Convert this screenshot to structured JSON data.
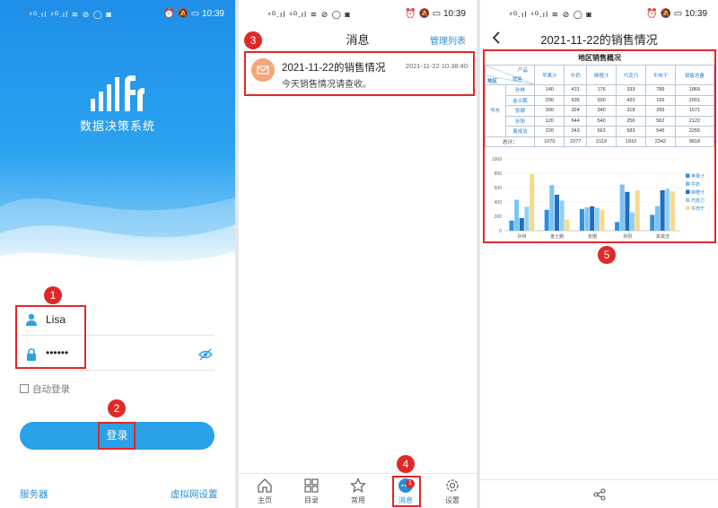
{
  "status": {
    "left_glyphs": "⁴ᴳ.ıl ⁴ᴳ.ıl ≋ ⊘ ◯ ◙",
    "right_glyphs": "⏰ 🔕 ▭",
    "time": "10:39"
  },
  "login": {
    "app_title": "数据决策系统",
    "username": "Lisa",
    "password_mask": "••••••",
    "auto_login": "自动登录",
    "login_button": "登录",
    "server_link": "服务器",
    "vpn_link": "虚拟网设置"
  },
  "messages": {
    "title": "消息",
    "manage": "管理列表",
    "item": {
      "title": "2021-11-22的销售情况",
      "time": "2021-11-22 10:38:40",
      "body": "今天销售情况请查收。"
    },
    "tabs": [
      {
        "label": "主页",
        "icon": "home-icon"
      },
      {
        "label": "目录",
        "icon": "grid-icon"
      },
      {
        "label": "常用",
        "icon": "star-icon"
      },
      {
        "label": "消息",
        "icon": "message-icon",
        "badge": "1"
      },
      {
        "label": "设置",
        "icon": "gear-icon"
      }
    ]
  },
  "report": {
    "title": "2021-11-22的销售情况",
    "table_title": "地区销售概况",
    "corner_product": "产品",
    "corner_seller": "销售",
    "corner_region": "地区",
    "products": [
      "苹果汁",
      "牛奶",
      "柳橙汁",
      "巧克力",
      "牛肉干",
      "销售总量"
    ],
    "region": "华东",
    "rows": [
      {
        "name": "孙林",
        "values": [
          "140",
          "431",
          "176",
          "333",
          "789",
          "1869"
        ]
      },
      {
        "name": "金士鹏",
        "values": [
          "290",
          "635",
          "500",
          "420",
          "156",
          "2001"
        ]
      },
      {
        "name": "张珊",
        "values": [
          "300",
          "324",
          "340",
          "318",
          "289",
          "1571"
        ]
      },
      {
        "name": "孙阳",
        "values": [
          "120",
          "644",
          "540",
          "256",
          "562",
          "2122"
        ]
      },
      {
        "name": "袁成洁",
        "values": [
          "220",
          "343",
          "563",
          "583",
          "546",
          "2255"
        ]
      }
    ],
    "total_label": "总计：",
    "totals": [
      "1070",
      "2377",
      "2119",
      "1910",
      "2342",
      "9818"
    ]
  },
  "chart_data": {
    "type": "bar",
    "categories": [
      "孙林",
      "金士鹏",
      "张珊",
      "孙阳",
      "袁成洁"
    ],
    "series": [
      {
        "name": "苹果汁",
        "values": [
          140,
          290,
          300,
          120,
          220
        ],
        "color": "#2d8fe0"
      },
      {
        "name": "牛奶",
        "values": [
          431,
          635,
          324,
          644,
          343
        ],
        "color": "#7cc3f0"
      },
      {
        "name": "柳橙汁",
        "values": [
          176,
          500,
          340,
          540,
          563
        ],
        "color": "#1f6fc0"
      },
      {
        "name": "巧克力",
        "values": [
          333,
          420,
          318,
          256,
          583
        ],
        "color": "#8fd0f2"
      },
      {
        "name": "牛肉干",
        "values": [
          789,
          156,
          289,
          562,
          546
        ],
        "color": "#f8d98c"
      }
    ],
    "yticks": [
      "0",
      "200",
      "400",
      "600",
      "800",
      "1000"
    ],
    "ylim": [
      0,
      1000
    ],
    "legend": "right",
    "grid": true
  },
  "annotations": [
    "1",
    "2",
    "3",
    "4",
    "5"
  ],
  "colors": {
    "accent": "#2aa1e8",
    "annotation": "#e02828"
  }
}
